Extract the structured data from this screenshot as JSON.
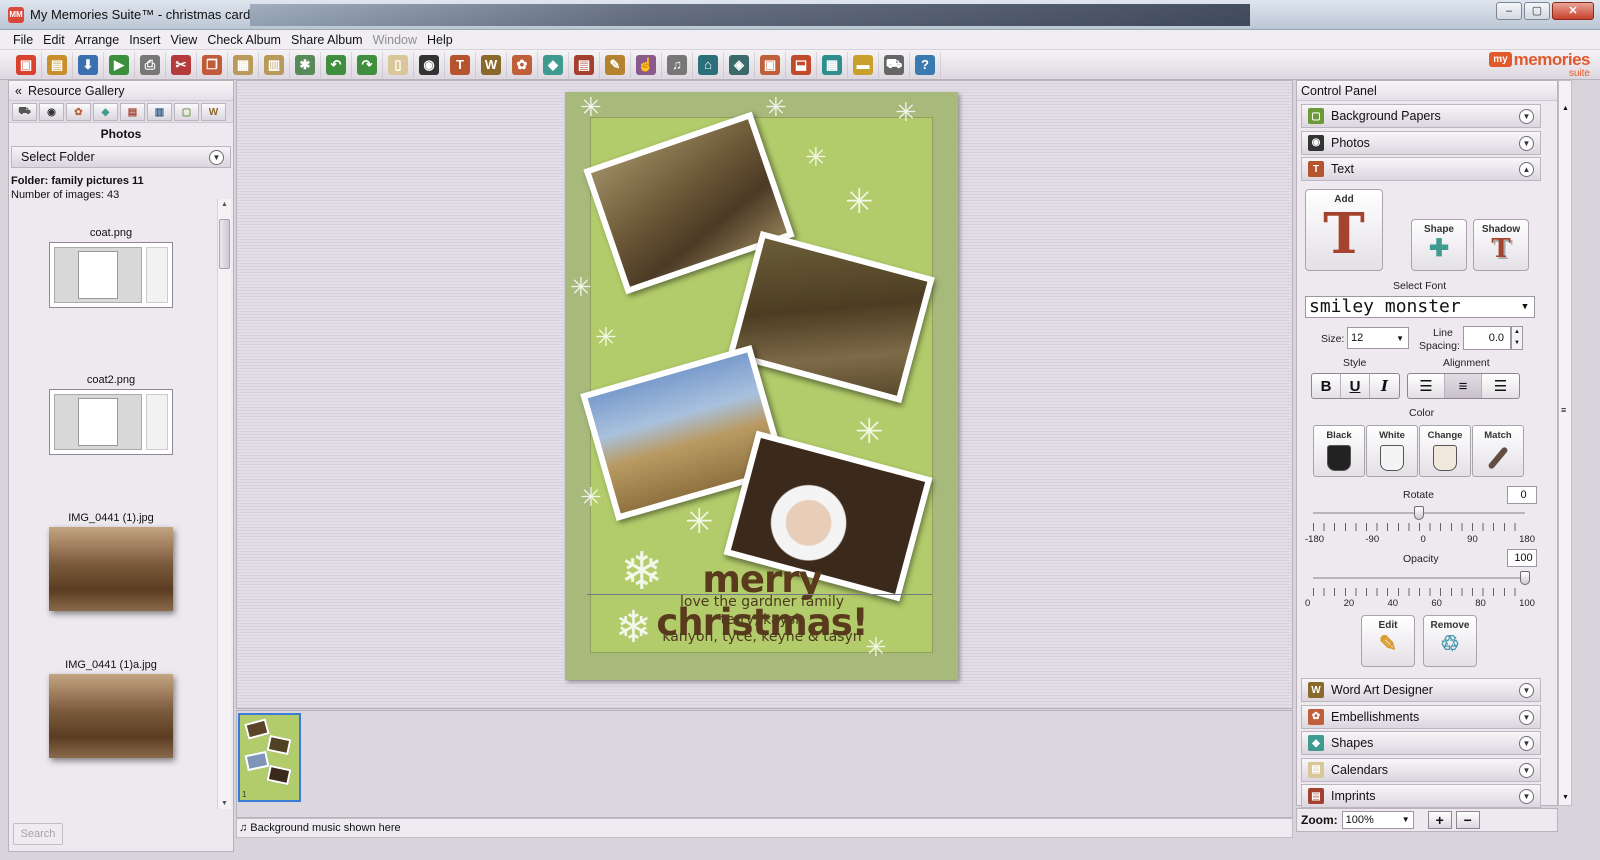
{
  "window": {
    "title": "My Memories Suite™ - christmas card",
    "controls": {
      "minimize": "–",
      "maximize": "▢",
      "close": "✕"
    }
  },
  "menu": [
    "File",
    "Edit",
    "Arrange",
    "Insert",
    "View",
    "Check Album",
    "Share Album",
    "Window",
    "Help"
  ],
  "menu_disabled": [
    "Window"
  ],
  "toolbar": {
    "icons": [
      {
        "name": "new-album-icon",
        "glyph": "▣",
        "color": "#d8432f"
      },
      {
        "name": "open-icon",
        "glyph": "▤",
        "color": "#c98f2c"
      },
      {
        "name": "save-icon",
        "glyph": "⬇",
        "color": "#3a6fb0"
      },
      {
        "name": "preview-icon",
        "glyph": "▶",
        "color": "#3c8f3c"
      },
      {
        "name": "print-icon",
        "glyph": "⎙",
        "color": "#777777"
      },
      {
        "name": "cut-icon",
        "glyph": "✂",
        "color": "#b33b3b"
      },
      {
        "name": "copy-icon",
        "glyph": "❐",
        "color": "#c05a3a"
      },
      {
        "name": "paste-icon",
        "glyph": "▦",
        "color": "#b89a5a"
      },
      {
        "name": "paste-special-icon",
        "glyph": "▥",
        "color": "#b89a5a"
      },
      {
        "name": "tools-icon",
        "glyph": "✱",
        "color": "#5a8a5a"
      },
      {
        "name": "undo-icon",
        "glyph": "↶",
        "color": "#3f8f3f"
      },
      {
        "name": "redo-icon",
        "glyph": "↷",
        "color": "#3f8f3f"
      },
      {
        "name": "blank-page-icon",
        "glyph": "▯",
        "color": "#d9c79a"
      },
      {
        "name": "camera-icon",
        "glyph": "◉",
        "color": "#333333"
      },
      {
        "name": "text-icon",
        "glyph": "T",
        "color": "#b5542f"
      },
      {
        "name": "word-art-icon",
        "glyph": "W",
        "color": "#8a6a2a"
      },
      {
        "name": "embellishment-icon",
        "glyph": "✿",
        "color": "#c0603a"
      },
      {
        "name": "shapes-icon",
        "glyph": "◆",
        "color": "#3f9a8f"
      },
      {
        "name": "film-icon",
        "glyph": "▤",
        "color": "#a3402e"
      },
      {
        "name": "brush-icon",
        "glyph": "✎",
        "color": "#b5822f"
      },
      {
        "name": "recolor-icon",
        "glyph": "☝",
        "color": "#8a5a8a"
      },
      {
        "name": "music-icon",
        "glyph": "♫",
        "color": "#777777"
      },
      {
        "name": "home-icon",
        "glyph": "⌂",
        "color": "#2a6f7a"
      },
      {
        "name": "page-icon",
        "glyph": "◈",
        "color": "#3a6a6a"
      },
      {
        "name": "layers-icon",
        "glyph": "▣",
        "color": "#c0603a"
      },
      {
        "name": "stamp-icon",
        "glyph": "⬓",
        "color": "#c04a2a"
      },
      {
        "name": "grid-icon",
        "glyph": "▦",
        "color": "#2f8f8f"
      },
      {
        "name": "filmstrip-icon",
        "glyph": "▬",
        "color": "#c8a02a"
      },
      {
        "name": "cart-icon",
        "glyph": "⛟",
        "color": "#666666"
      },
      {
        "name": "help-icon",
        "glyph": "?",
        "color": "#3a7ab0"
      }
    ]
  },
  "brand": {
    "my": "my",
    "memories": "memories",
    "suite": "suite"
  },
  "left_panel": {
    "title": "Resource Gallery",
    "collapse_glyph": "«",
    "tabs": [
      {
        "name": "cart-tab-icon",
        "glyph": "⛟",
        "color": "#555555"
      },
      {
        "name": "photos-tab-icon",
        "glyph": "◉",
        "color": "#333333"
      },
      {
        "name": "embellishments-tab-icon",
        "glyph": "✿",
        "color": "#c0603a"
      },
      {
        "name": "shapes-tab-icon",
        "glyph": "◆",
        "color": "#3f9a8f"
      },
      {
        "name": "film-tab-icon",
        "glyph": "▤",
        "color": "#a3402e"
      },
      {
        "name": "layouts-tab-icon",
        "glyph": "▥",
        "color": "#2a5a8a"
      },
      {
        "name": "papers-tab-icon",
        "glyph": "▢",
        "color": "#6a9a3a"
      },
      {
        "name": "word-art-tab-icon",
        "glyph": "W",
        "color": "#8a6a2a"
      }
    ],
    "section_title": "Photos",
    "folder_dropdown": "Select Folder",
    "folder_label": "Folder: family pictures 11",
    "count_label": "Number of images: 43",
    "images": [
      {
        "name": "coat.png",
        "kind": "screenshot"
      },
      {
        "name": "coat2.png",
        "kind": "screenshot"
      },
      {
        "name": "IMG_0441 (1).jpg",
        "kind": "photo"
      },
      {
        "name": "IMG_0441 (1)a.jpg",
        "kind": "photo"
      }
    ],
    "search_button": "Search"
  },
  "card": {
    "headline": "merry christmas!",
    "line1": "love the gardner family",
    "line2": "terry, kaysi,",
    "line3": "kanyon, tyce, keyne & tasyn"
  },
  "page_strip": {
    "page_number": "1"
  },
  "music_bar": {
    "text": "Background music shown here"
  },
  "control_panel": {
    "title": "Control Panel",
    "sections_top": [
      {
        "label": "Background Papers",
        "icon_color": "#6a9a3a",
        "glyph": "▢",
        "state": "collapsed"
      },
      {
        "label": "Photos",
        "icon_color": "#333333",
        "glyph": "◉",
        "state": "collapsed"
      },
      {
        "label": "Text",
        "icon_color": "#b5542f",
        "glyph": "T",
        "state": "expanded"
      }
    ],
    "text_tools": {
      "add_label": "Add",
      "shape_label": "Shape",
      "shadow_label": "Shadow",
      "select_font_label": "Select Font",
      "font_value": "smiley monster",
      "size_label": "Size:",
      "size_value": "12",
      "line_spacing_label_1": "Line",
      "line_spacing_label_2": "Spacing:",
      "line_spacing_value": "0.0",
      "style_label": "Style",
      "alignment_label": "Alignment",
      "style_buttons": [
        "B",
        "U",
        "I"
      ],
      "color_label": "Color",
      "color_buttons": [
        {
          "label": "Black",
          "fill": "#222222"
        },
        {
          "label": "White",
          "fill": "#f4f4f4"
        },
        {
          "label": "Change",
          "fill": "#f1e7dc"
        },
        {
          "label": "Match",
          "fill": "#6a4a3a"
        }
      ],
      "rotate_label": "Rotate",
      "rotate_value": "0",
      "rotate_range": [
        -180,
        180
      ],
      "rotate_ticks": [
        "-180",
        "-90",
        "0",
        "90",
        "180"
      ],
      "opacity_label": "Opacity",
      "opacity_value": "100",
      "opacity_range": [
        0,
        100
      ],
      "opacity_ticks": [
        "0",
        "20",
        "40",
        "60",
        "80",
        "100"
      ],
      "edit_label": "Edit",
      "remove_label": "Remove"
    },
    "sections_bottom": [
      {
        "label": "Word Art Designer",
        "icon_color": "#8a6a2a",
        "glyph": "W"
      },
      {
        "label": "Embellishments",
        "icon_color": "#c0603a",
        "glyph": "✿"
      },
      {
        "label": "Shapes",
        "icon_color": "#3f9a8f",
        "glyph": "◆"
      },
      {
        "label": "Calendars",
        "icon_color": "#d9c79a",
        "glyph": "▤"
      },
      {
        "label": "Imprints",
        "icon_color": "#a3402e",
        "glyph": "▤"
      }
    ],
    "zoom_label": "Zoom:",
    "zoom_value": "100%",
    "zoom_in": "+",
    "zoom_out": "−"
  }
}
